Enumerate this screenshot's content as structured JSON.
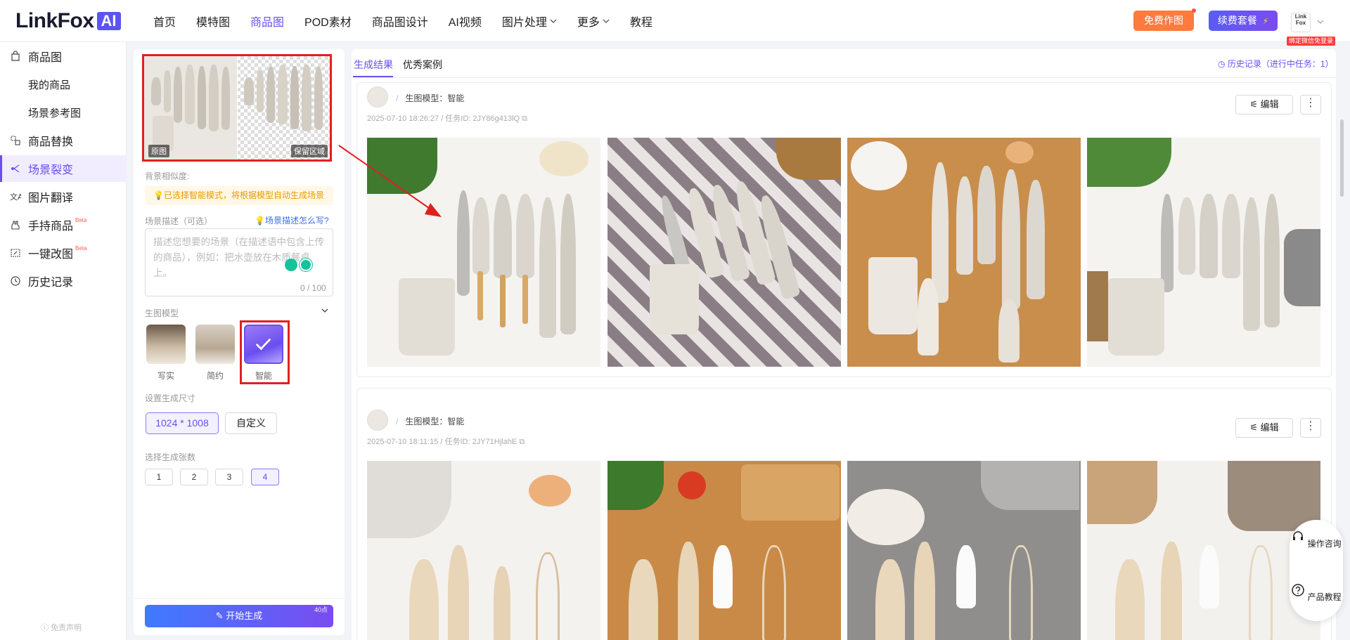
{
  "topnav": {
    "logo_text": "LinkFox",
    "logo_badge": "AI",
    "menu": [
      {
        "label": "首页",
        "active": false,
        "chevron": false
      },
      {
        "label": "模特图",
        "active": false,
        "chevron": false
      },
      {
        "label": "商品图",
        "active": true,
        "chevron": false
      },
      {
        "label": "POD素材",
        "active": false,
        "chevron": false
      },
      {
        "label": "商品图设计",
        "active": false,
        "chevron": false
      },
      {
        "label": "AI视频",
        "active": false,
        "chevron": false
      },
      {
        "label": "图片处理",
        "active": false,
        "chevron": true
      },
      {
        "label": "更多",
        "active": false,
        "chevron": true
      },
      {
        "label": "教程",
        "active": false,
        "chevron": false
      }
    ],
    "free_button": "免费作图",
    "renew_button": "续费套餐",
    "renew_icon": "lightning-icon",
    "avatar_text": "Link Fox",
    "bind_wechat": "绑定微信免登录"
  },
  "sidebar": {
    "items": [
      {
        "label": "商品图",
        "icon": "bag-icon",
        "sub": false,
        "active": false,
        "beta": ""
      },
      {
        "label": "我的商品",
        "icon": "",
        "sub": true,
        "active": false,
        "beta": ""
      },
      {
        "label": "场景参考图",
        "icon": "",
        "sub": true,
        "active": false,
        "beta": ""
      },
      {
        "label": "商品替换",
        "icon": "swap-icon",
        "sub": false,
        "active": false,
        "beta": ""
      },
      {
        "label": "场景裂变",
        "icon": "split-icon",
        "sub": false,
        "active": true,
        "beta": ""
      },
      {
        "label": "图片翻译",
        "icon": "translate-icon",
        "sub": false,
        "active": false,
        "beta": ""
      },
      {
        "label": "手持商品",
        "icon": "hand-icon",
        "sub": false,
        "active": false,
        "beta": "Beta"
      },
      {
        "label": "一键改图",
        "icon": "edit-image-icon",
        "sub": false,
        "active": false,
        "beta": "Beta"
      },
      {
        "label": "历史记录",
        "icon": "clock-icon",
        "sub": false,
        "active": false,
        "beta": ""
      }
    ],
    "disclaimer": "免责声明"
  },
  "panel": {
    "preview_left_tag": "原图",
    "preview_right_tag": "保留区域",
    "similarity_label": "背景相似度:",
    "smart_hint": "已选择智能模式，将根据模型自动生成场景",
    "desc_label": "场景描述（可选）",
    "desc_help": "场景描述怎么写?",
    "desc_placeholder": "描述您想要的场景（在描述语中包含上传的商品），例如：把水壶放在木质餐桌上。",
    "desc_count": "0 / 100",
    "model_label": "生图模型",
    "models": [
      {
        "label": "写实",
        "selected": false
      },
      {
        "label": "简约",
        "selected": false
      },
      {
        "label": "智能",
        "selected": true
      }
    ],
    "size_label": "设置生成尺寸",
    "size_options": [
      {
        "label": "1024 * 1008",
        "selected": true
      },
      {
        "label": "自定义",
        "selected": false
      }
    ],
    "count_label": "选择生成张数",
    "count_options": [
      {
        "label": "1",
        "selected": false
      },
      {
        "label": "2",
        "selected": false
      },
      {
        "label": "3",
        "selected": false
      },
      {
        "label": "4",
        "selected": true
      }
    ],
    "generate_button": "开始生成",
    "generate_cost": "40点"
  },
  "results": {
    "tabs": [
      {
        "label": "生成结果",
        "active": true
      },
      {
        "label": "优秀案例",
        "active": false
      }
    ],
    "history_link": "历史记录（进行中任务：1）",
    "cards": [
      {
        "model": "生图模型：智能",
        "meta": "2025-07-10 18:26:27 / 任务ID: 2JY86g413lQ",
        "edit": "编辑",
        "more": "⋮"
      },
      {
        "model": "生图模型：智能",
        "meta": "2025-07-10 18:11:15 / 任务ID: 2JY71HjlahE",
        "edit": "编辑",
        "more": "⋮"
      }
    ],
    "separator": "/"
  },
  "float_help": {
    "consult": "操作咨询",
    "tutorial": "产品教程"
  },
  "colors": {
    "accent": "#6a4ef0",
    "highlight_red": "#e02020",
    "free_orange": "#ff7a3d"
  }
}
